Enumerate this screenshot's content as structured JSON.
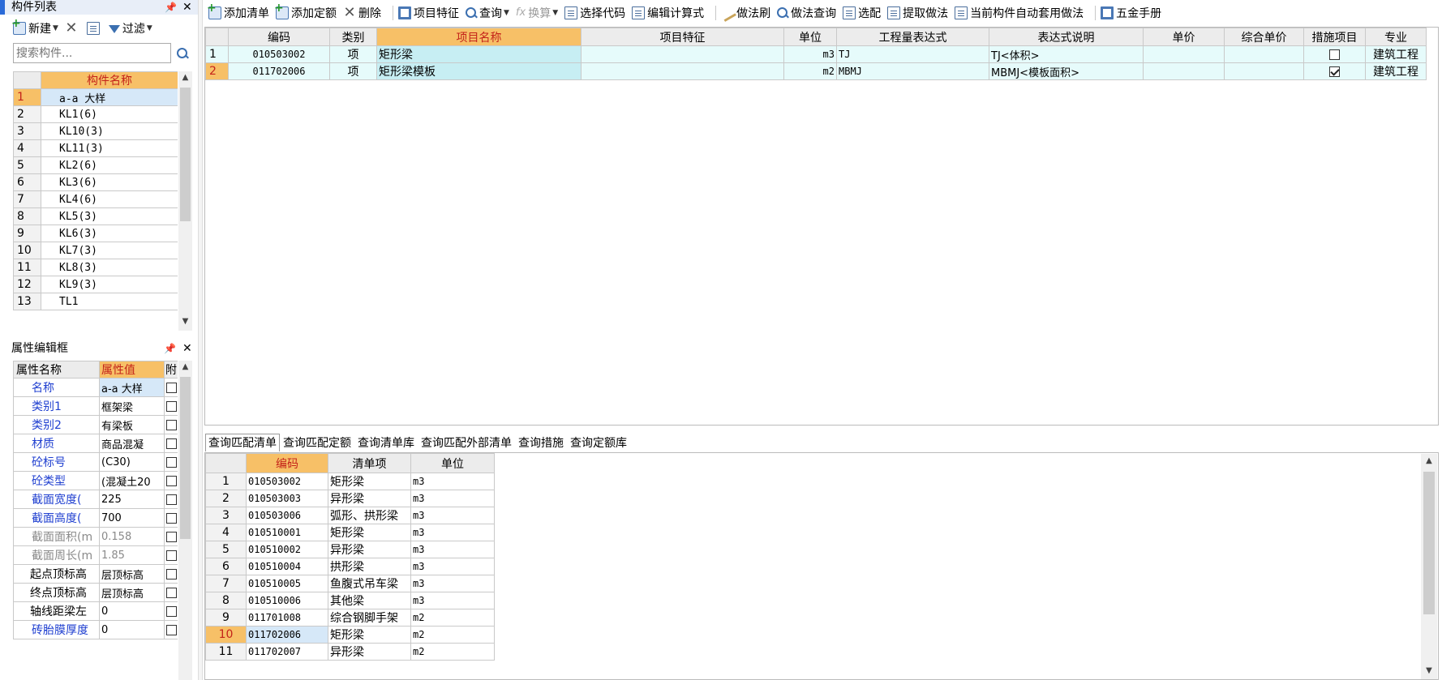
{
  "left_panel": {
    "title": "构件列表",
    "pin": "ᵖ",
    "close": "✕",
    "toolbar": {
      "new_label": "新建",
      "filter_label": "过滤"
    },
    "search": {
      "placeholder": "搜索构件..."
    },
    "header": "构件名称",
    "rows": [
      {
        "n": "1",
        "name": "a-a 大样"
      },
      {
        "n": "2",
        "name": "KL1(6)"
      },
      {
        "n": "3",
        "name": "KL10(3)"
      },
      {
        "n": "4",
        "name": "KL11(3)"
      },
      {
        "n": "5",
        "name": "KL2(6)"
      },
      {
        "n": "6",
        "name": "KL3(6)"
      },
      {
        "n": "7",
        "name": "KL4(6)"
      },
      {
        "n": "8",
        "name": "KL5(3)"
      },
      {
        "n": "9",
        "name": "KL6(3)"
      },
      {
        "n": "10",
        "name": "KL7(3)"
      },
      {
        "n": "11",
        "name": "KL8(3)"
      },
      {
        "n": "12",
        "name": "KL9(3)"
      },
      {
        "n": "13",
        "name": "TL1"
      }
    ]
  },
  "prop_panel": {
    "title": "属性编辑框",
    "headers": [
      "属性名称",
      "属性值",
      "附"
    ],
    "rows": [
      {
        "name": "名称",
        "value": "a-a 大样",
        "style": "blue"
      },
      {
        "name": "类别1",
        "value": "框架梁",
        "style": "blue"
      },
      {
        "name": "类别2",
        "value": "有梁板",
        "style": "blue"
      },
      {
        "name": "材质",
        "value": "商品混凝",
        "style": "blue"
      },
      {
        "name": "砼标号",
        "value": "(C30)",
        "style": "blue"
      },
      {
        "name": "砼类型",
        "value": "(混凝土20",
        "style": "blue"
      },
      {
        "name": "截面宽度(",
        "value": "225",
        "style": "blue"
      },
      {
        "name": "截面高度(",
        "value": "700",
        "style": "blue"
      },
      {
        "name": "截面面积(m",
        "value": "0.158",
        "style": "gray"
      },
      {
        "name": "截面周长(m",
        "value": "1.85",
        "style": "gray"
      },
      {
        "name": "起点顶标高",
        "value": "层顶标高",
        "style": "black"
      },
      {
        "name": "终点顶标高",
        "value": "层顶标高",
        "style": "black"
      },
      {
        "name": "轴线距梁左",
        "value": "0",
        "style": "black"
      },
      {
        "name": "砖胎膜厚度",
        "value": "0",
        "style": "blue"
      }
    ]
  },
  "toolbar": {
    "items": [
      {
        "key": "add_list",
        "label": "添加清单",
        "icon": "add-list-icon"
      },
      {
        "key": "add_quota",
        "label": "添加定额",
        "icon": "add-quota-icon"
      },
      {
        "key": "delete",
        "label": "删除",
        "icon": "delete-icon"
      },
      {
        "key": "feature",
        "label": "项目特征",
        "icon": "feature-icon"
      },
      {
        "key": "query",
        "label": "查询",
        "icon": "search-icon",
        "dropdown": true
      },
      {
        "key": "convert",
        "label": "换算",
        "icon": "fx-icon",
        "dropdown": true,
        "disabled": true
      },
      {
        "key": "select_code",
        "label": "选择代码",
        "icon": "select-code-icon"
      },
      {
        "key": "edit_formula",
        "label": "编辑计算式",
        "icon": "edit-formula-icon"
      },
      {
        "key": "method_brush",
        "label": "做法刷",
        "icon": "brush-icon"
      },
      {
        "key": "method_query",
        "label": "做法查询",
        "icon": "method-query-icon"
      },
      {
        "key": "match",
        "label": "选配",
        "icon": "match-icon"
      },
      {
        "key": "extract",
        "label": "提取做法",
        "icon": "extract-icon"
      },
      {
        "key": "auto_apply",
        "label": "当前构件自动套用做法",
        "icon": "auto-apply-icon"
      },
      {
        "key": "hardware",
        "label": "五金手册",
        "icon": "hardware-manual-icon"
      }
    ]
  },
  "main_table": {
    "headers": [
      "编码",
      "类别",
      "项目名称",
      "项目特征",
      "单位",
      "工程量表达式",
      "表达式说明",
      "单价",
      "综合单价",
      "措施项目",
      "专业"
    ],
    "rows": [
      {
        "n": "1",
        "code": "010503002",
        "type": "项",
        "name": "矩形梁",
        "feature": "",
        "unit": "m3",
        "expr": "TJ",
        "desc": "TJ<体积>",
        "price": "",
        "total": "",
        "measure": false,
        "major": "建筑工程"
      },
      {
        "n": "2",
        "code": "011702006",
        "type": "项",
        "name": "矩形梁模板",
        "feature": "",
        "unit": "m2",
        "expr": "MBMJ",
        "desc": "MBMJ<模板面积>",
        "price": "",
        "total": "",
        "measure": true,
        "major": "建筑工程"
      }
    ]
  },
  "bottom_tabs": [
    "查询匹配清单",
    "查询匹配定额",
    "查询清单库",
    "查询匹配外部清单",
    "查询措施",
    "查询定额库"
  ],
  "bottom_table": {
    "headers": [
      "编码",
      "清单项",
      "单位"
    ],
    "rows": [
      {
        "n": "1",
        "code": "010503002",
        "item": "矩形梁",
        "unit": "m3"
      },
      {
        "n": "2",
        "code": "010503003",
        "item": "异形梁",
        "unit": "m3"
      },
      {
        "n": "3",
        "code": "010503006",
        "item": "弧形、拱形梁",
        "unit": "m3"
      },
      {
        "n": "4",
        "code": "010510001",
        "item": "矩形梁",
        "unit": "m3"
      },
      {
        "n": "5",
        "code": "010510002",
        "item": "异形梁",
        "unit": "m3"
      },
      {
        "n": "6",
        "code": "010510004",
        "item": "拱形梁",
        "unit": "m3"
      },
      {
        "n": "7",
        "code": "010510005",
        "item": "鱼腹式吊车梁",
        "unit": "m3"
      },
      {
        "n": "8",
        "code": "010510006",
        "item": "其他梁",
        "unit": "m3"
      },
      {
        "n": "9",
        "code": "011701008",
        "item": "综合钢脚手架",
        "unit": "m2"
      },
      {
        "n": "10",
        "code": "011702006",
        "item": "矩形梁",
        "unit": "m2"
      },
      {
        "n": "11",
        "code": "011702007",
        "item": "异形梁",
        "unit": "m2"
      }
    ]
  }
}
